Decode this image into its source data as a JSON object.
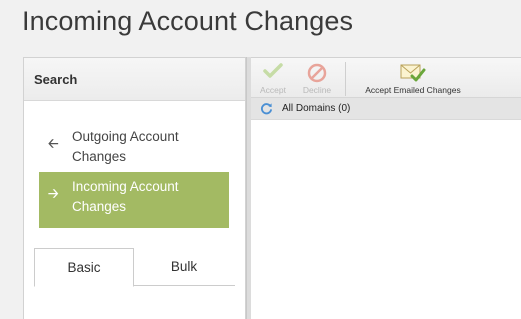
{
  "page": {
    "title": "Incoming Account Changes"
  },
  "sidebar": {
    "header": "Search",
    "items": [
      {
        "label": "Outgoing Account Changes",
        "icon": "arrow-left-icon",
        "selected": false
      },
      {
        "label": "Incoming Account Changes",
        "icon": "arrow-right-icon",
        "selected": true
      }
    ],
    "tabs": [
      {
        "label": "Basic",
        "active": true
      },
      {
        "label": "Bulk",
        "active": false
      }
    ]
  },
  "toolbar": {
    "accept_label": "Accept",
    "decline_label": "Decline",
    "emailed_label": "Accept Emailed Changes"
  },
  "tree": {
    "root_label": "All Domains (0)"
  },
  "colors": {
    "selected_bg": "#a3ba63",
    "accent_green": "#8cbf3f",
    "decline_red": "#e8a49a",
    "refresh_blue": "#4a8fd4"
  }
}
